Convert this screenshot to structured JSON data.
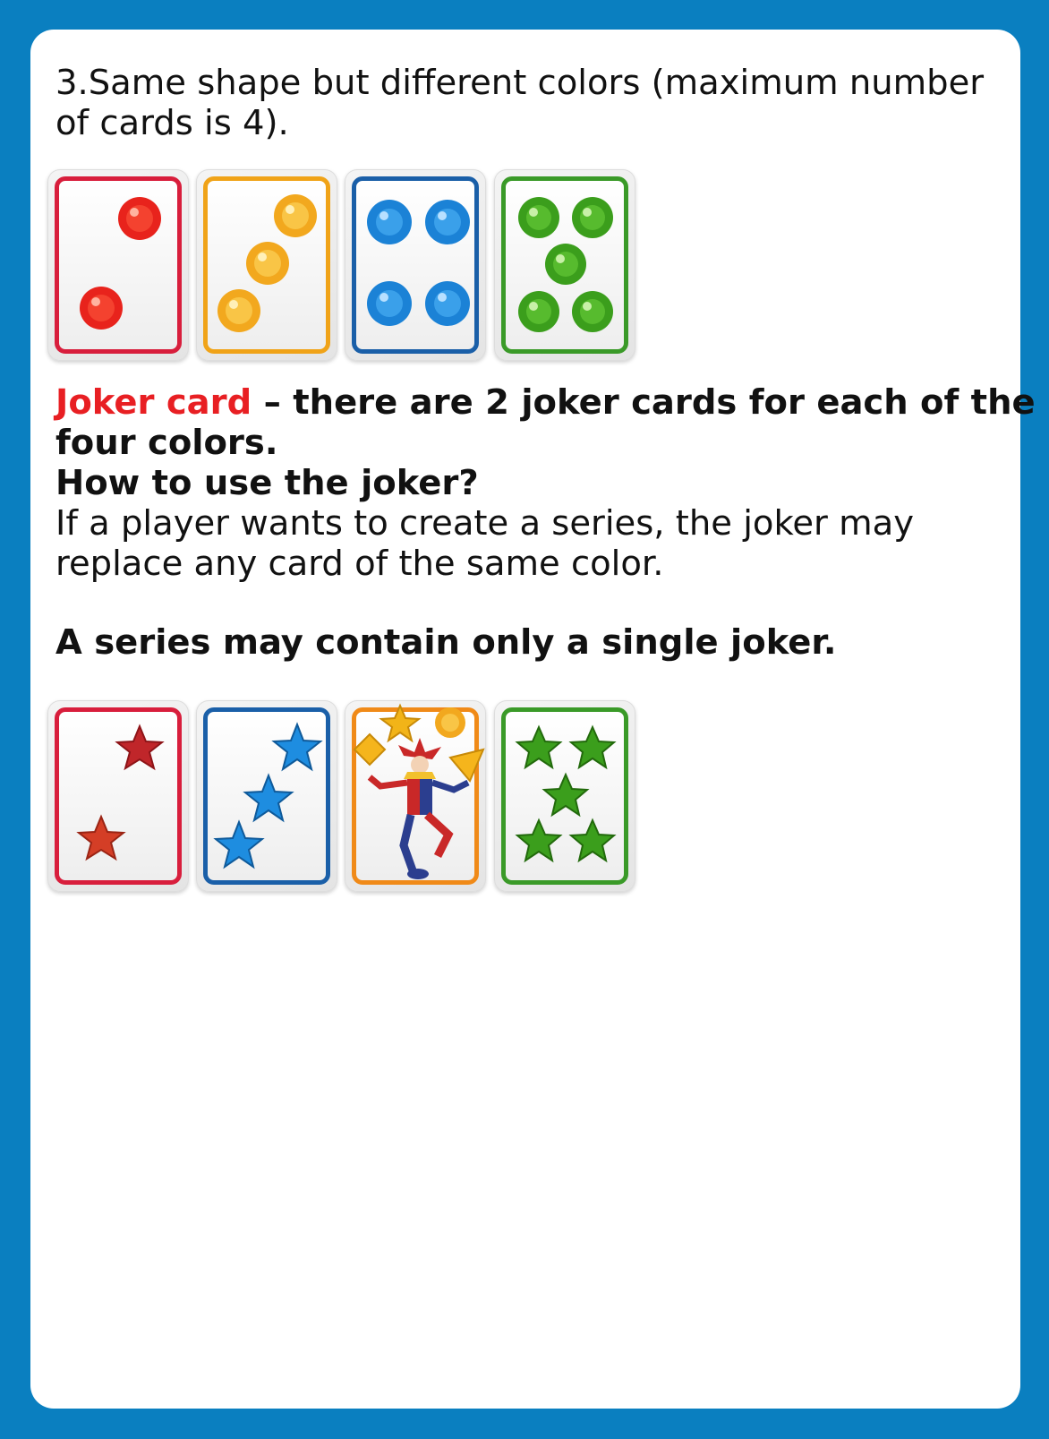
{
  "rule_text": {
    "line1": "3.Same shape but different colors (maximum number",
    "line2": "of cards is 4)."
  },
  "joker": {
    "label": "Joker card",
    "desc_line1": " – there are 2 joker cards for each of the",
    "desc_line2": "four colors.",
    "question": "How to use the joker?",
    "answer_line1": "If a player wants to create a series, the joker may",
    "answer_line2": "replace any card of the same color.",
    "rule": "A series may contain only a single joker."
  },
  "colors": {
    "red": "#d81e3c",
    "orange": "#f0a318",
    "blue": "#1a5fa8",
    "green": "#3a9a28",
    "frame": "#0a7fc0"
  },
  "card_row_1": [
    {
      "color": "red",
      "symbol": "gem",
      "count": 2
    },
    {
      "color": "orange",
      "symbol": "gem",
      "count": 3
    },
    {
      "color": "blue",
      "symbol": "gem",
      "count": 4
    },
    {
      "color": "green",
      "symbol": "gem",
      "count": 5
    }
  ],
  "card_row_2": [
    {
      "color": "red",
      "symbol": "star",
      "count": 2
    },
    {
      "color": "blue",
      "symbol": "star",
      "count": 3
    },
    {
      "color": "orange",
      "symbol": "joker-icon",
      "count": 1
    },
    {
      "color": "green",
      "symbol": "star",
      "count": 5
    }
  ]
}
